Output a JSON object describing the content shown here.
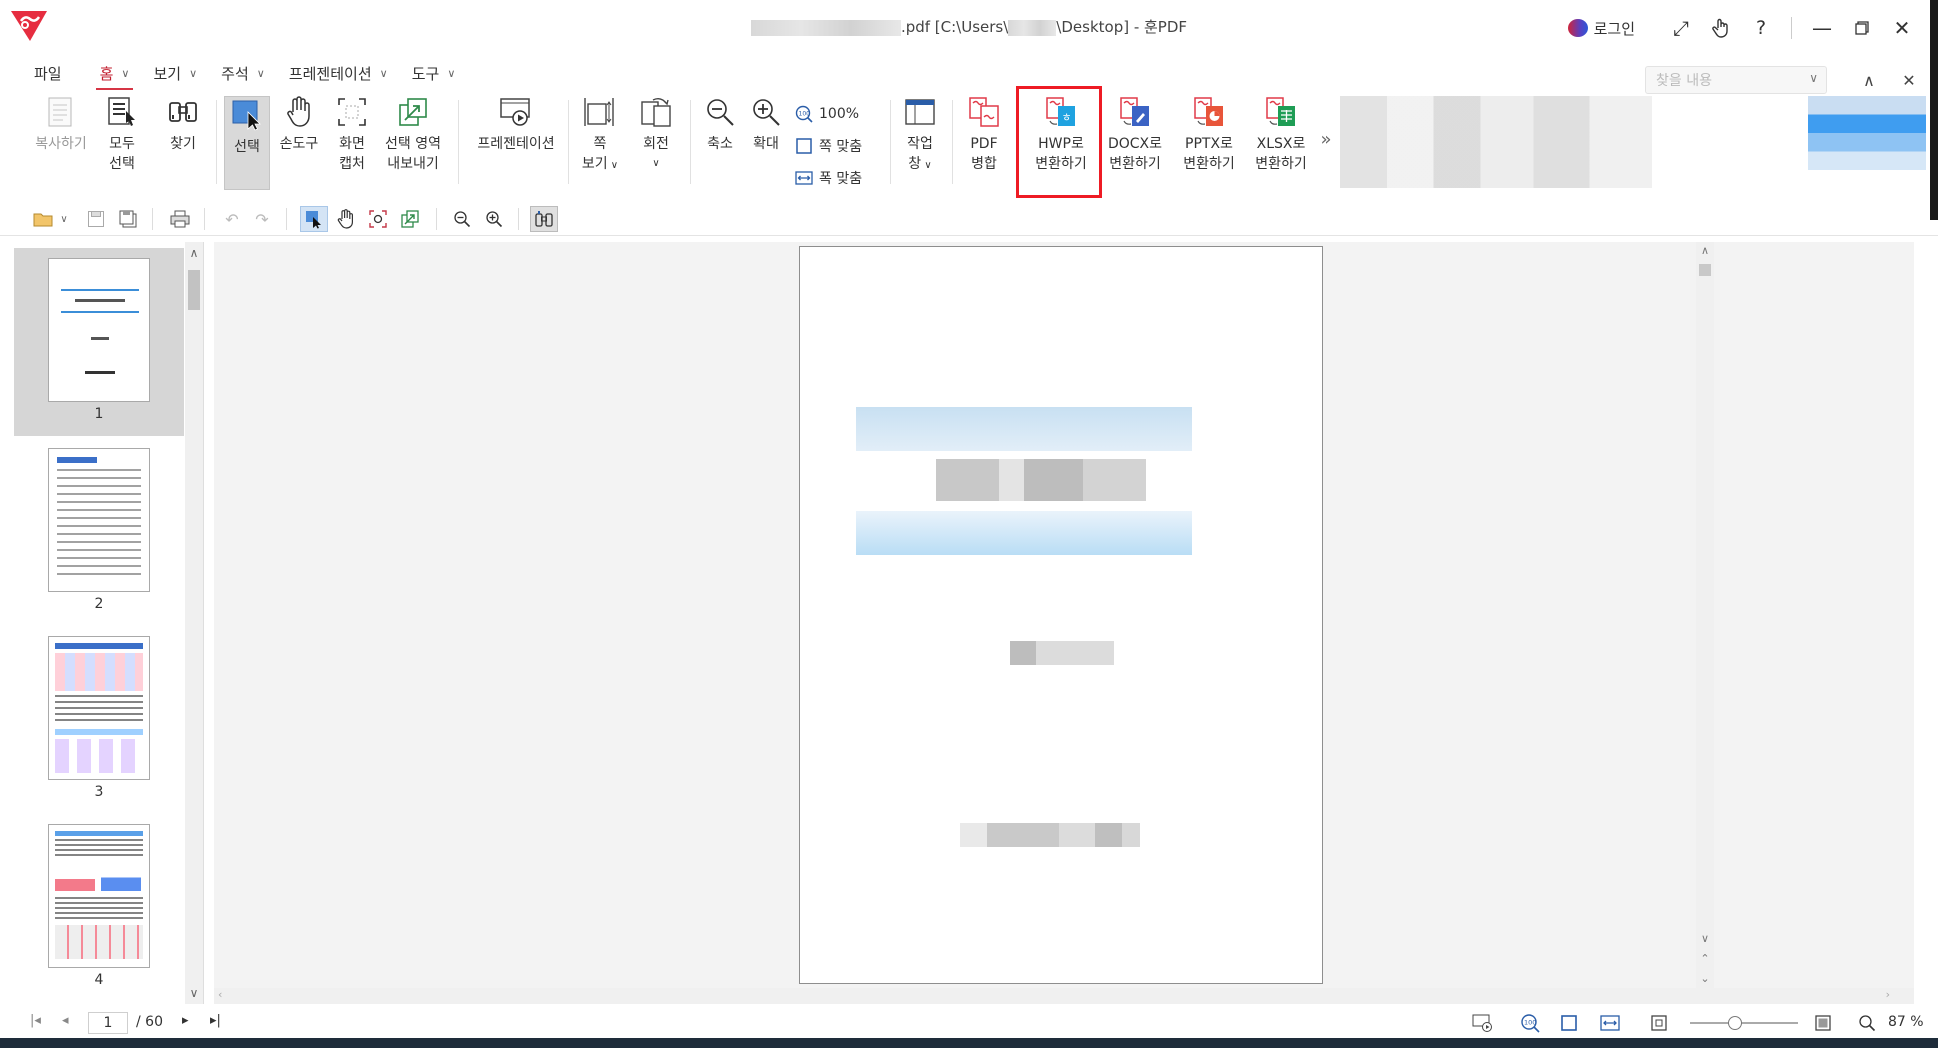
{
  "title": {
    "filename_suffix": ".pdf [C:\\Users\\",
    "path_suffix": "\\Desktop] - 훈PDF"
  },
  "window": {
    "login_label": "로그인"
  },
  "menu": {
    "file": "파일",
    "tabs": [
      "홈",
      "보기",
      "주석",
      "프레젠테이션",
      "도구"
    ],
    "search_placeholder": "찾을 내용"
  },
  "ribbon": {
    "copy": "복사하기",
    "select_all": [
      "모두",
      "선택"
    ],
    "find": "찾기",
    "select": "선택",
    "hand_tool": "손도구",
    "screen_capture": [
      "화면",
      "캡처"
    ],
    "export_area": [
      "선택 영역",
      "내보내기"
    ],
    "presentation": "프레젠테이션",
    "page_view": [
      "쪽",
      "보기"
    ],
    "rotate": "회전",
    "zoom_out": "축소",
    "zoom_in": "확대",
    "zoom_100": "100%",
    "fit_page": "쪽 맞춤",
    "fit_width": "폭 맞춤",
    "task_pane": [
      "작업",
      "창"
    ],
    "pdf_merge": [
      "PDF",
      "병합"
    ],
    "to_hwp": [
      "HWP로",
      "변환하기"
    ],
    "to_docx": [
      "DOCX로",
      "변환하기"
    ],
    "to_pptx": [
      "PPTX로",
      "변환하기"
    ],
    "to_xlsx": [
      "XLSX로",
      "변환하기"
    ],
    "more": "»"
  },
  "thumbnails": {
    "pages": [
      "1",
      "2",
      "3",
      "4"
    ]
  },
  "status": {
    "current_page": "1",
    "total_pages": "/ 60",
    "zoom": "87 %"
  },
  "colors": {
    "accent": "#d63545",
    "highlight": "#ee1b24",
    "hwp_blue": "#1fa2e0",
    "docx_blue": "#3b63c4",
    "pptx_orange": "#e8553a",
    "xlsx_green": "#1f9d55"
  }
}
